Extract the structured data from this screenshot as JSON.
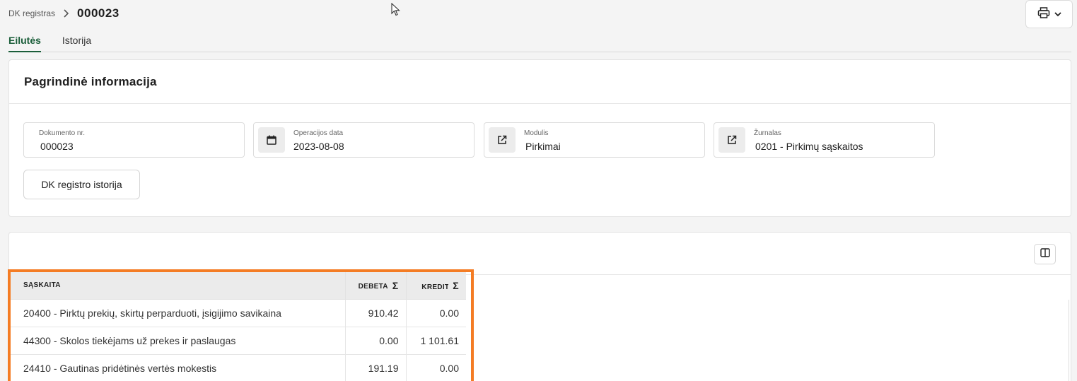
{
  "breadcrumb": {
    "root": "DK registras",
    "current": "000023"
  },
  "tabs": [
    {
      "label": "Eilutės",
      "active": true
    },
    {
      "label": "Istorija",
      "active": false
    }
  ],
  "main_info": {
    "title": "Pagrindinė informacija",
    "fields": [
      {
        "label": "Dokumento nr.",
        "value": "000023",
        "icon": null
      },
      {
        "label": "Operacijos data",
        "value": "2023-08-08",
        "icon": "calendar-icon"
      },
      {
        "label": "Modulis",
        "value": "Pirkimai",
        "icon": "external-link-icon"
      },
      {
        "label": "Žurnalas",
        "value": "0201 - Pirkimų sąskaitos",
        "icon": "external-link-icon"
      }
    ],
    "history_button": "DK registro istorija"
  },
  "lines": {
    "columns": {
      "account": "SĄSKAITA",
      "debit": "DEBETA",
      "credit": "KREDITAS",
      "sum_symbol": "Σ"
    },
    "rows": [
      {
        "account": "20400 - Pirktų prekių, skirtų perparduoti, įsigijimo savikaina",
        "debit": "910.42",
        "credit": "0.00"
      },
      {
        "account": "44300 - Skolos tiekėjams už prekes ir paslaugas",
        "debit": "0.00",
        "credit": "1 101.61"
      },
      {
        "account": "24410 - Gautinas pridėtinės vertės mokestis",
        "debit": "191.19",
        "credit": "0.00"
      }
    ]
  },
  "colors": {
    "accent_green": "#1b5e3a",
    "highlight_orange": "#f47c24"
  },
  "icons": [
    "chevron-right-icon",
    "printer-icon",
    "chevron-down-icon",
    "calendar-icon",
    "external-link-icon",
    "columns-icon",
    "cursor-icon"
  ]
}
